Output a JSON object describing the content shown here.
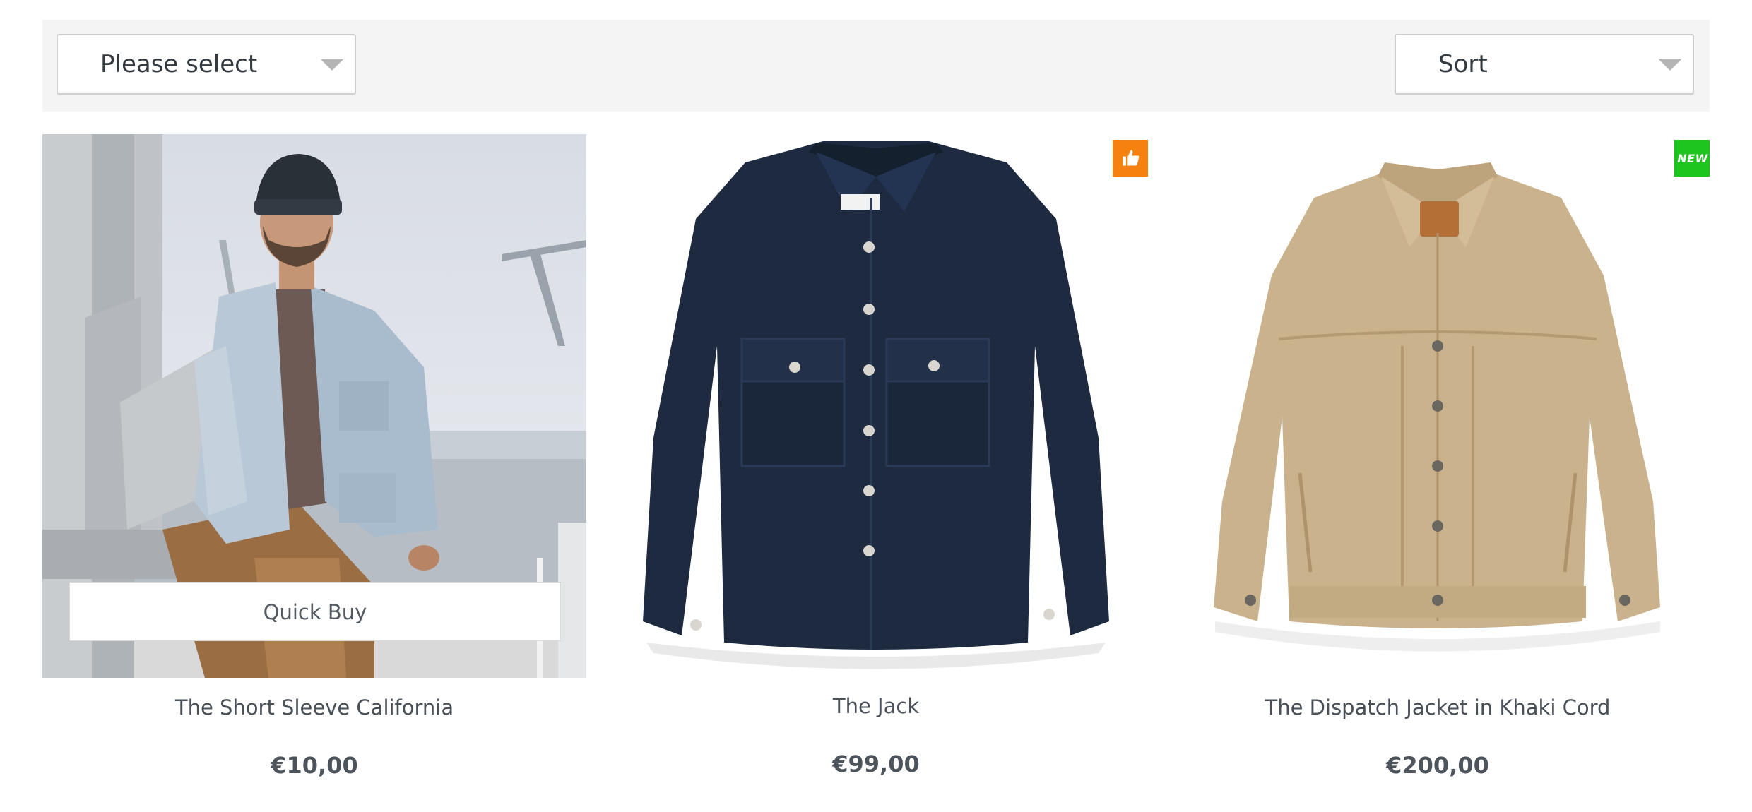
{
  "filters": {
    "category_select": {
      "value": "Please select"
    },
    "sort_select": {
      "value": "Sort"
    }
  },
  "products": [
    {
      "title": "The Short Sleeve California",
      "price": "€10,00",
      "quick_buy_label": "Quick Buy",
      "image": "man-in-light-denim-jacket-and-beanie"
    },
    {
      "title": "The Jack",
      "price": "€99,00",
      "badge": {
        "icon": "thumbs-up-icon",
        "color": "#f5820f"
      },
      "image": "navy-denim-shirt-jacket"
    },
    {
      "title": "The Dispatch Jacket in Khaki Cord",
      "price": "€200,00",
      "badge": {
        "text": "NEW",
        "color": "#1fc51f"
      },
      "image": "khaki-corduroy-jacket"
    }
  ]
}
